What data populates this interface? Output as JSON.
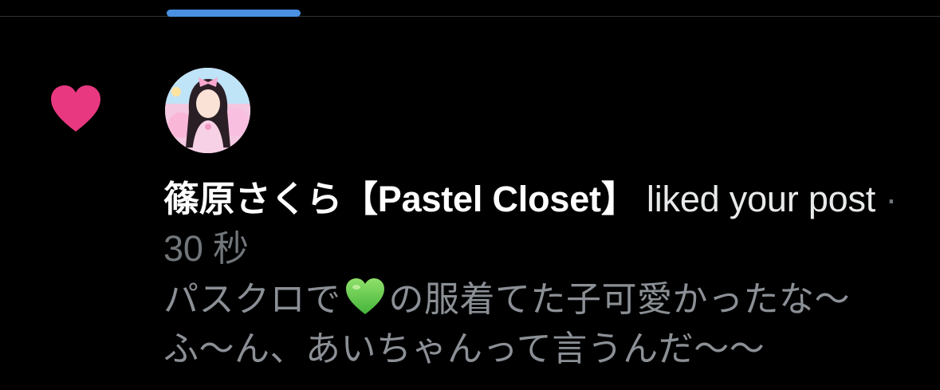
{
  "tabs": {
    "active_indicator_color": "#4a90e2"
  },
  "notification": {
    "icon": "heart-icon",
    "icon_color": "#e8387f",
    "avatar": "user-avatar",
    "username": "篠原さくら【Pastel Closet】",
    "action": " liked your post",
    "separator": " · ",
    "time": "30 秒",
    "preview_part1": "パスクロで",
    "preview_emoji": "green-heart-emoji",
    "preview_part2": "の服着てた子可愛かったな〜ふ〜ん、あいちゃんって言うんだ〜〜"
  }
}
